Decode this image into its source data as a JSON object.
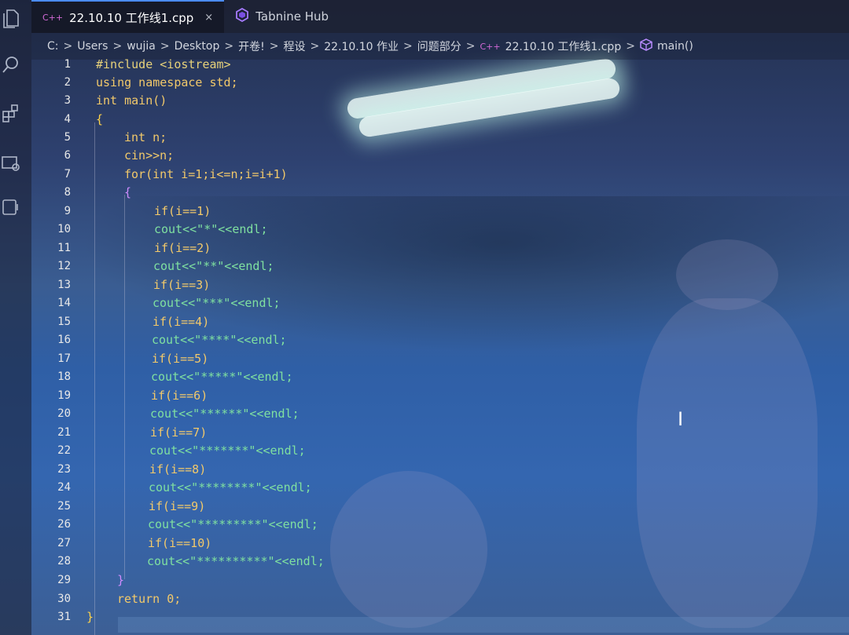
{
  "tabs": [
    {
      "badge": "C++",
      "label": "22.10.10 工作线1.cpp",
      "active": true,
      "close": "×"
    },
    {
      "badge": "tabnine-icon",
      "label": "Tabnine Hub",
      "active": false
    }
  ],
  "breadcrumb": {
    "items": [
      "C:",
      "Users",
      "wujia",
      "Desktop",
      "开卷!",
      "程设",
      "22.10.10 作业",
      "问题部分",
      "22.10.10 工作线1.cpp",
      "main()"
    ],
    "separator": ">"
  },
  "editor": {
    "lines": [
      {
        "n": "1"
      },
      {
        "n": "2"
      },
      {
        "n": "3"
      },
      {
        "n": "4"
      },
      {
        "n": "5"
      },
      {
        "n": "6"
      },
      {
        "n": "7"
      },
      {
        "n": "8"
      },
      {
        "n": "9"
      },
      {
        "n": "10"
      },
      {
        "n": "11"
      },
      {
        "n": "12"
      },
      {
        "n": "13"
      },
      {
        "n": "14"
      },
      {
        "n": "15"
      },
      {
        "n": "16"
      },
      {
        "n": "17"
      },
      {
        "n": "18"
      },
      {
        "n": "19"
      },
      {
        "n": "20"
      },
      {
        "n": "21"
      },
      {
        "n": "22"
      },
      {
        "n": "23"
      },
      {
        "n": "24"
      },
      {
        "n": "25"
      },
      {
        "n": "26"
      },
      {
        "n": "27"
      },
      {
        "n": "28"
      },
      {
        "n": "29"
      },
      {
        "n": "30"
      },
      {
        "n": "31"
      }
    ],
    "code": {
      "l1": "#include <iostream>",
      "l2": "using namespace std;",
      "l3": "int main()",
      "l4": "{",
      "l5": "int n;",
      "l6": "cin>>n;",
      "l7": "for(int i=1;i<=n;i=i+1)",
      "l8": "{",
      "l9": "if(i==1)",
      "l10": "cout<<\"*\"<<endl;",
      "l11": "if(i==2)",
      "l12": "cout<<\"**\"<<endl;",
      "l13": "if(i==3)",
      "l14": "cout<<\"***\"<<endl;",
      "l15": "if(i==4)",
      "l16": "cout<<\"****\"<<endl;",
      "l17": "if(i==5)",
      "l18": "cout<<\"*****\"<<endl;",
      "l19": "if(i==6)",
      "l20": "cout<<\"******\"<<endl;",
      "l21": "if(i==7)",
      "l22": "cout<<\"*******\"<<endl;",
      "l23": "if(i==8)",
      "l24": "cout<<\"********\"<<endl;",
      "l25": "if(i==9)",
      "l26": "cout<<\"*********\"<<endl;",
      "l27": "if(i==10)",
      "l28": "cout<<\"**********\"<<endl;",
      "l29": "}",
      "l30": "return 0;",
      "l31": "}"
    }
  },
  "colors": {
    "keyword": "#f2c96a",
    "string": "#7fe0a0",
    "number": "#ff8fb3",
    "paren": "#d08cff",
    "active_tab_border": "#4b8cff"
  },
  "icons": [
    "explorer-icon",
    "search-icon",
    "extensions-icon",
    "remote-explorer-icon",
    "tabnine-icon",
    "cube-icon",
    "text-cursor-icon"
  ]
}
